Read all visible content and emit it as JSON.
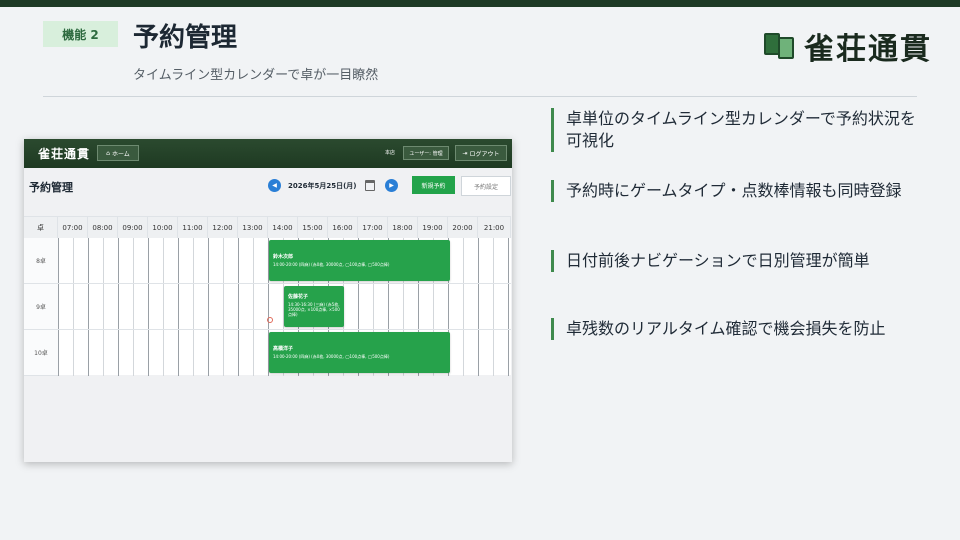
{
  "slide": {
    "badge": "機能 2",
    "title": "予約管理",
    "subtitle": "タイムライン型カレンダーで卓が一目瞭然",
    "logo_text": "雀荘通貫"
  },
  "app": {
    "logo": "雀荘通貫",
    "home_label": "ホーム",
    "store_label": "本店",
    "user_label": "ユーザー: 管理",
    "logout_label": "ログアウト",
    "page_title": "予約管理",
    "date": "2026年5月25日(月)",
    "new_label": "新規予約",
    "settings_label": "予約設定",
    "corner_label": "卓",
    "times": [
      "07:00",
      "08:00",
      "09:00",
      "10:00",
      "11:00",
      "12:00",
      "13:00",
      "14:00",
      "15:00",
      "16:00",
      "17:00",
      "18:00",
      "19:00",
      "20:00",
      "21:00"
    ],
    "tables": [
      "8卓",
      "9卓",
      "10卓"
    ],
    "reservations": [
      {
        "name": "鈴木次郎",
        "detail": "14:00-20:00 (四麻) (赤0枚, 30000点, ◯100点棒, ◯500点棒)"
      },
      {
        "name": "佐藤花子",
        "detail": "14:30-16:30 (三麻) (赤5枚, 35000点, ×100点棒, ×500点棒)"
      },
      {
        "name": "高橋洋子",
        "detail": "14:00-20:00 (四麻) (赤0枚, 30000点, ◯100点棒, ◯500点棒)"
      }
    ]
  },
  "points": [
    "卓単位のタイムライン型カレンダーで予約状況を可視化",
    "予約時にゲームタイプ・点数棒情報も同時登録",
    "日付前後ナビゲーションで日別管理が簡単",
    "卓残数のリアルタイム確認で機会損失を防止"
  ],
  "colors": {
    "accent": "#26a24b",
    "header": "#1e3a26",
    "nav": "#2a7fd6"
  }
}
